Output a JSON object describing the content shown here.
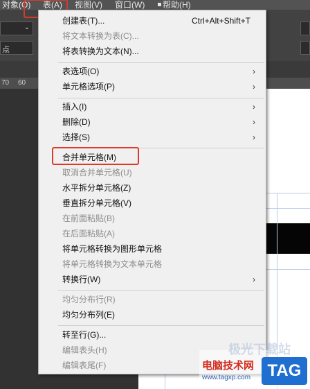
{
  "menubar": {
    "items": [
      "对象(O)",
      "表(A)",
      "视图(V)",
      "窗口(W)",
      "帮助(H)"
    ]
  },
  "toolbar": {
    "label": "点"
  },
  "ruler": {
    "ticks": [
      "70",
      "60"
    ]
  },
  "menu": {
    "items": [
      {
        "label": "创建表(T)...",
        "shortcut": "Ctrl+Alt+Shift+T"
      },
      {
        "label": "将文本转换为表(C)..."
      },
      {
        "label": "将表转换为文本(N)..."
      },
      {
        "label": "表选项(O)"
      },
      {
        "label": "单元格选项(P)"
      },
      {
        "label": "插入(I)"
      },
      {
        "label": "删除(D)"
      },
      {
        "label": "选择(S)"
      },
      {
        "label": "合并单元格(M)"
      },
      {
        "label": "取消合并单元格(U)"
      },
      {
        "label": "水平拆分单元格(Z)"
      },
      {
        "label": "垂直拆分单元格(V)"
      },
      {
        "label": "在前面粘贴(B)"
      },
      {
        "label": "在后面粘贴(A)"
      },
      {
        "label": "将单元格转换为图形单元格"
      },
      {
        "label": "将单元格转换为文本单元格"
      },
      {
        "label": "转换行(W)"
      },
      {
        "label": "均匀分布行(R)"
      },
      {
        "label": "均匀分布列(E)"
      },
      {
        "label": "转至行(G)..."
      },
      {
        "label": "编辑表头(H)"
      },
      {
        "label": "编辑表尾(F)"
      }
    ]
  },
  "watermark": {
    "site": "电脑技术网",
    "url": "www.tagxp.com",
    "tag": "TAG",
    "faint": "极光下载站"
  }
}
